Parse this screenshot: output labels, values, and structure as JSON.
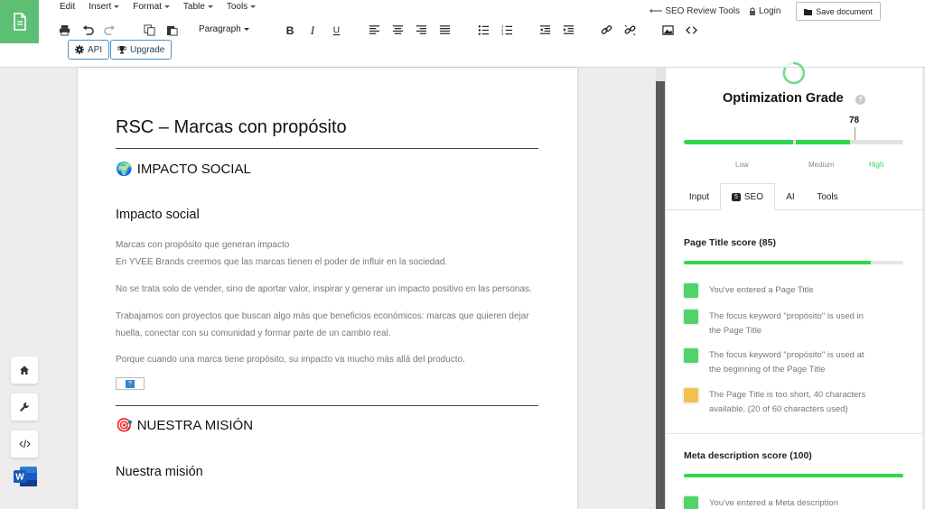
{
  "menu": [
    {
      "label": "Edit"
    },
    {
      "label": "Insert"
    },
    {
      "label": "Format"
    },
    {
      "label": "Table"
    },
    {
      "label": "Tools"
    }
  ],
  "toolbar": {
    "block_format": "Paragraph",
    "api_label": "API",
    "upgrade_label": "Upgrade",
    "seo_tools_label": "SEO Review Tools",
    "login_label": "Login",
    "save_label": "Save document"
  },
  "document": {
    "title": "RSC – Marcas con propósito",
    "section1": {
      "emoji": "🌍",
      "heading": "IMPACTO SOCIAL",
      "subheading": "Impacto social"
    },
    "paragraphs": [
      [
        "Marcas con propósito que generan impacto",
        "En YVEE Brands creemos que las marcas tienen el poder de influir en la sociedad."
      ],
      [
        "No se trata solo de vender, sino de aportar valor, inspirar y generar un impacto positivo en las personas."
      ],
      [
        "Trabajamos con proyectos que buscan algo más que beneficios económicos: marcas que quieren dejar",
        "huella, conectar con su comunidad y formar parte de un cambio real."
      ],
      [
        "Porque cuando una marca tiene propósito, su impacto va mucho más allá del producto."
      ]
    ],
    "placeholder_glyph": "?",
    "section2": {
      "emoji": "🎯",
      "heading": "NUESTRA MISIÓN",
      "subheading": "Nuestra misión"
    }
  },
  "sidebar_tools": [
    {
      "icon": "home-icon"
    },
    {
      "icon": "wrench-icon"
    },
    {
      "icon": "code-icon"
    },
    {
      "icon": "word-icon",
      "letter": "W"
    }
  ],
  "panel": {
    "grade_title": "Optimization Grade",
    "help_glyph": "?",
    "grade_value": "78",
    "grade_fraction": 0.78,
    "levels": [
      "Low",
      "Medium",
      "High"
    ],
    "active_level_color": "#2fd84b",
    "tabs": [
      {
        "label": "Input"
      },
      {
        "label": "SEO",
        "badge": "5"
      },
      {
        "label": "AI"
      },
      {
        "label": "Tools"
      }
    ],
    "page_title_score": {
      "title": "Page Title score (85)",
      "value": 85,
      "checks": [
        {
          "status": "good",
          "text": [
            "You've entered a Page Title"
          ]
        },
        {
          "status": "good",
          "text": [
            "The focus keyword \"propósito\" is used in",
            "the Page Title"
          ]
        },
        {
          "status": "good",
          "text": [
            "The focus keyword \"propósito\" is used at",
            "the beginning of the Page Title"
          ]
        },
        {
          "status": "warn",
          "text": [
            "The Page Title is too short, 40 characters",
            "available. (20 of 60 characters used)"
          ]
        }
      ]
    },
    "meta_score": {
      "title": "Meta description score (100)",
      "value": 100,
      "checks": [
        {
          "status": "good",
          "text": [
            "You've entered a Meta description"
          ]
        }
      ]
    },
    "colors": {
      "good": "#4fd36a",
      "warn": "#f2c14e",
      "accent": "#2fd84b"
    }
  }
}
